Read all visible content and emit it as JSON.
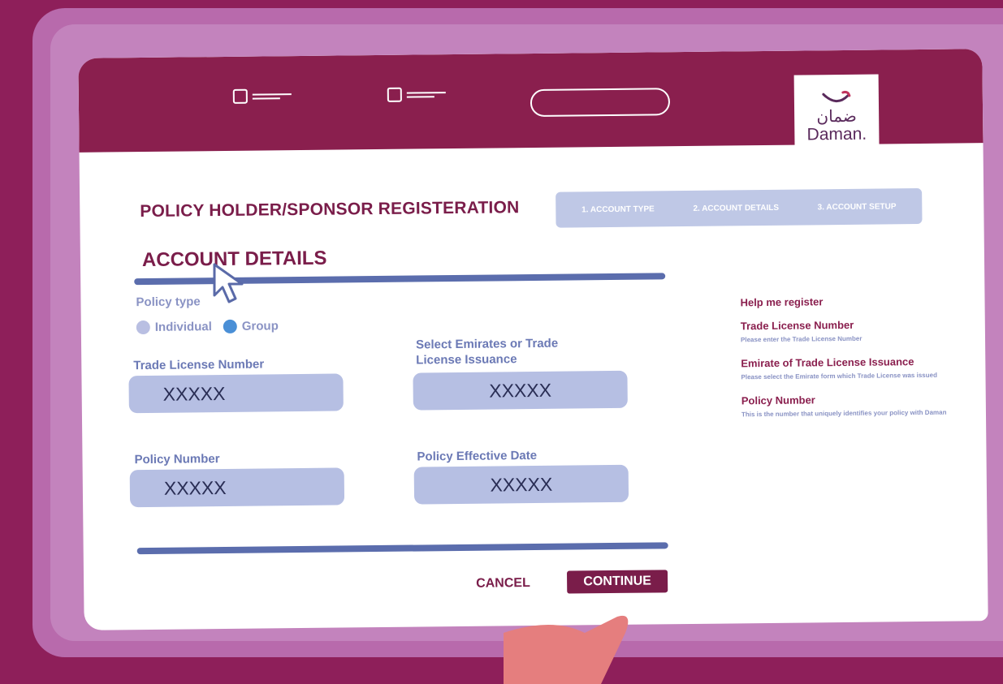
{
  "colors": {
    "background": "#8e1f5a",
    "topbar": "#8a1f4e",
    "brand": "#7a1d4a",
    "field": "#b6bfe3",
    "divider": "#5b6dad",
    "label": "#6b79b5",
    "radio_selected": "#4a8fd6",
    "radio_unselected": "#b9bfe2"
  },
  "nav": {
    "icons": [
      "menu-item-icon",
      "menu-item-icon",
      "search-bar"
    ]
  },
  "logo": {
    "arabic": "ضمان",
    "latin": "Daman."
  },
  "page": {
    "registration_title": "POLICY HOLDER/SPONSOR REGISTERATION",
    "section_title": "ACCOUNT DETAILS"
  },
  "steps": [
    "1. ACCOUNT TYPE",
    "2. ACCOUNT DETAILS",
    "3. ACCOUNT SETUP"
  ],
  "form": {
    "policy_type_label": "Policy type",
    "policy_type_options": [
      {
        "label": "Individual",
        "selected": false
      },
      {
        "label": "Group",
        "selected": true
      }
    ],
    "trade_license_label": "Trade License Number",
    "trade_license_value": "XXXXX",
    "emirate_label_line1": "Select Emirates or Trade",
    "emirate_label_line2": "License Issuance",
    "emirate_value": "XXXXX",
    "policy_number_label": "Policy Number",
    "policy_number_value": "XXXXX",
    "effective_date_label": "Policy Effective Date",
    "effective_date_value": "XXXXX"
  },
  "actions": {
    "cancel": "CANCEL",
    "continue": "CONTINUE"
  },
  "help": {
    "title": "Help me register",
    "items": [
      {
        "heading": "Trade License Number",
        "description": "Please enter the Trade License Number"
      },
      {
        "heading": "Emirate of Trade License Issuance",
        "description": "Please select the Emirate form which Trade License was issued"
      },
      {
        "heading": "Policy Number",
        "description": "This is the number that uniquely identifies your policy with Daman"
      }
    ]
  }
}
